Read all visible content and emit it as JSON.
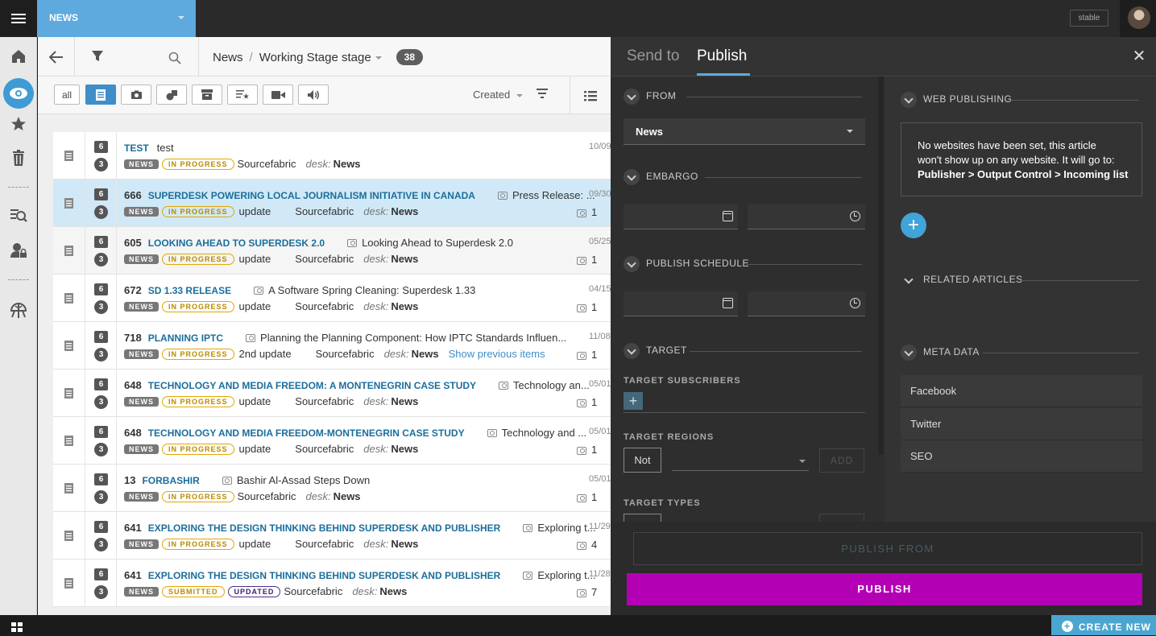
{
  "topbar": {
    "desk": "NEWS",
    "version_badge": "stable"
  },
  "breadcrumb": {
    "root": "News",
    "stage": "Working Stage stage",
    "count": "38"
  },
  "filters": {
    "all_label": "all",
    "sort_label": "Created"
  },
  "colors": {
    "accent": "#5ea9dd",
    "publish": "#b400b4",
    "slug": "#1b6e9c",
    "in_progress": "#e0a800"
  },
  "rows": [
    {
      "v1": "6",
      "v2": "3",
      "num": "",
      "slug": "TEST",
      "headline": "test",
      "has_cam": false,
      "tags": [
        "NEWS",
        "IN PROGRESS"
      ],
      "update": "",
      "source": "Sourcefabric",
      "desk_label": "desk:",
      "desk": "News",
      "date": "10/09",
      "count": "",
      "extra": ""
    },
    {
      "v1": "6",
      "v2": "3",
      "num": "666",
      "slug": "SUPERDESK POWERING LOCAL JOURNALISM INITIATIVE IN CANADA",
      "headline": "Press Release: ...",
      "has_cam": true,
      "tags": [
        "NEWS",
        "IN PROGRESS"
      ],
      "update": "update",
      "source": "Sourcefabric",
      "desk_label": "desk:",
      "desk": "News",
      "date": "09/30",
      "count": "1",
      "extra": ""
    },
    {
      "v1": "6",
      "v2": "3",
      "num": "605",
      "slug": "LOOKING AHEAD TO SUPERDESK 2.0",
      "headline": "Looking Ahead to Superdesk 2.0",
      "has_cam": true,
      "tags": [
        "NEWS",
        "IN PROGRESS"
      ],
      "update": "update",
      "source": "Sourcefabric",
      "desk_label": "desk:",
      "desk": "News",
      "date": "05/25",
      "count": "1",
      "extra": ""
    },
    {
      "v1": "6",
      "v2": "3",
      "num": "672",
      "slug": "SD 1.33 RELEASE",
      "headline": "A Software Spring Cleaning: Superdesk 1.33",
      "has_cam": true,
      "tags": [
        "NEWS",
        "IN PROGRESS"
      ],
      "update": "update",
      "source": "Sourcefabric",
      "desk_label": "desk:",
      "desk": "News",
      "date": "04/15",
      "count": "1",
      "extra": ""
    },
    {
      "v1": "6",
      "v2": "3",
      "num": "718",
      "slug": "PLANNING IPTC",
      "headline": "Planning the Planning Component: How IPTC Standards Influen...",
      "has_cam": true,
      "tags": [
        "NEWS",
        "IN PROGRESS"
      ],
      "update": "2nd update",
      "source": "Sourcefabric",
      "desk_label": "desk:",
      "desk": "News",
      "date": "11/08",
      "count": "1",
      "extra": "Show previous items"
    },
    {
      "v1": "6",
      "v2": "3",
      "num": "648",
      "slug": "TECHNOLOGY AND MEDIA FREEDOM: A MONTENEGRIN CASE STUDY",
      "headline": "Technology an...",
      "has_cam": true,
      "tags": [
        "NEWS",
        "IN PROGRESS"
      ],
      "update": "update",
      "source": "Sourcefabric",
      "desk_label": "desk:",
      "desk": "News",
      "date": "05/01",
      "count": "1",
      "extra": ""
    },
    {
      "v1": "6",
      "v2": "3",
      "num": "648",
      "slug": "TECHNOLOGY AND MEDIA FREEDOM-MONTENEGRIN CASE STUDY",
      "headline": "Technology and ...",
      "has_cam": true,
      "tags": [
        "NEWS",
        "IN PROGRESS"
      ],
      "update": "update",
      "source": "Sourcefabric",
      "desk_label": "desk:",
      "desk": "News",
      "date": "05/01",
      "count": "1",
      "extra": ""
    },
    {
      "v1": "6",
      "v2": "3",
      "num": "13",
      "slug": "FORBASHIR",
      "headline": "Bashir Al-Assad Steps Down",
      "has_cam": true,
      "tags": [
        "NEWS",
        "IN PROGRESS"
      ],
      "update": "",
      "source": "Sourcefabric",
      "desk_label": "desk:",
      "desk": "News",
      "date": "05/01",
      "count": "1",
      "extra": ""
    },
    {
      "v1": "6",
      "v2": "3",
      "num": "641",
      "slug": "EXPLORING THE DESIGN THINKING BEHIND SUPERDESK AND PUBLISHER",
      "headline": "Exploring t...",
      "has_cam": true,
      "tags": [
        "NEWS",
        "IN PROGRESS"
      ],
      "update": "update",
      "source": "Sourcefabric",
      "desk_label": "desk:",
      "desk": "News",
      "date": "11/29",
      "count": "4",
      "extra": ""
    },
    {
      "v1": "6",
      "v2": "3",
      "num": "641",
      "slug": "EXPLORING THE DESIGN THINKING BEHIND SUPERDESK AND PUBLISHER",
      "headline": "Exploring t...",
      "has_cam": true,
      "tags": [
        "NEWS",
        "SUBMITTED",
        "UPDATED"
      ],
      "update": "",
      "source": "Sourcefabric",
      "desk_label": "desk:",
      "desk": "News",
      "date": "11/28",
      "count": "7",
      "extra": ""
    }
  ],
  "panel": {
    "tab_send": "Send to",
    "tab_publish": "Publish",
    "from_label": "FROM",
    "from_value": "News",
    "embargo_label": "EMBARGO",
    "schedule_label": "PUBLISH SCHEDULE",
    "target_label": "TARGET",
    "target_subscribers": "TARGET SUBSCRIBERS",
    "target_regions": "TARGET REGIONS",
    "not_label": "Not",
    "add_label": "ADD",
    "target_types": "TARGET TYPES",
    "web_publishing": "WEB PUBLISHING",
    "web_msg_1": "No websites have been set, this article",
    "web_msg_2": "won't show up on any website. It will go to:",
    "web_msg_3": "Publisher > Output Control > Incoming list",
    "related_articles": "RELATED ARTICLES",
    "meta_data": "META DATA",
    "meta_items": [
      "Facebook",
      "Twitter",
      "SEO"
    ],
    "publish_from": "PUBLISH FROM",
    "publish": "PUBLISH"
  },
  "bottom": {
    "create_new": "CREATE NEW"
  }
}
